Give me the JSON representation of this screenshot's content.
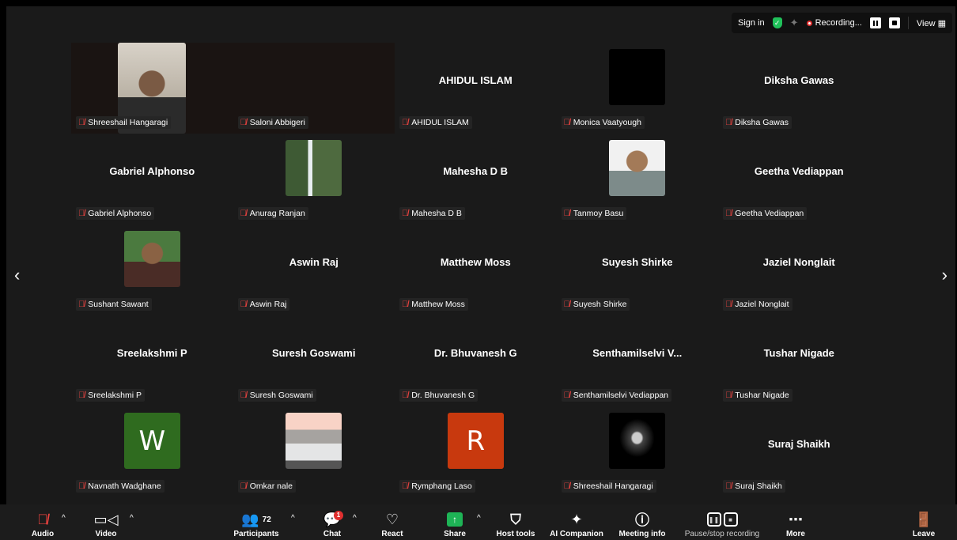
{
  "topbar": {
    "sign_in": "Sign in",
    "recording": "Recording...",
    "view": "View"
  },
  "tiles": [
    {
      "label": "Shreeshail Hangaragi",
      "name_center": ""
    },
    {
      "label": "Saloni Abbigeri",
      "name_center": ""
    },
    {
      "label": "AHIDUL ISLAM",
      "name_center": "AHIDUL ISLAM"
    },
    {
      "label": "Monica Vaatyough",
      "name_center": ""
    },
    {
      "label": "Diksha Gawas",
      "name_center": "Diksha Gawas"
    },
    {
      "label": "Gabriel Alphonso",
      "name_center": "Gabriel Alphonso"
    },
    {
      "label": "Anurag Ranjan",
      "name_center": ""
    },
    {
      "label": "Mahesha D B",
      "name_center": "Mahesha D B"
    },
    {
      "label": "Tanmoy Basu",
      "name_center": ""
    },
    {
      "label": "Geetha Vediappan",
      "name_center": "Geetha Vediappan"
    },
    {
      "label": "Sushant Sawant",
      "name_center": ""
    },
    {
      "label": "Aswin Raj",
      "name_center": "Aswin Raj"
    },
    {
      "label": "Matthew Moss",
      "name_center": "Matthew Moss"
    },
    {
      "label": "Suyesh Shirke",
      "name_center": "Suyesh Shirke"
    },
    {
      "label": "Jaziel Nonglait",
      "name_center": "Jaziel Nonglait"
    },
    {
      "label": "Sreelakshmi P",
      "name_center": "Sreelakshmi P"
    },
    {
      "label": "Suresh Goswami",
      "name_center": "Suresh Goswami"
    },
    {
      "label": "Dr. Bhuvanesh G",
      "name_center": "Dr. Bhuvanesh G"
    },
    {
      "label": "Senthamilselvi Vediappan",
      "name_center": "Senthamilselvi  V..."
    },
    {
      "label": "Tushar Nigade",
      "name_center": "Tushar Nigade"
    },
    {
      "label": "Navnath Wadghane",
      "name_center": "",
      "avatar_letter": "W"
    },
    {
      "label": "Omkar nale",
      "name_center": ""
    },
    {
      "label": "Rymphang Laso",
      "name_center": "",
      "avatar_letter": "R"
    },
    {
      "label": "Shreeshail Hangaragi",
      "name_center": ""
    },
    {
      "label": "Suraj Shaikh",
      "name_center": "Suraj Shaikh"
    }
  ],
  "toolbar": {
    "audio": "Audio",
    "video": "Video",
    "participants": "Participants",
    "participants_count": "72",
    "chat": "Chat",
    "chat_badge": "1",
    "react": "React",
    "share": "Share",
    "host_tools": "Host tools",
    "ai_companion": "AI Companion",
    "meeting_info": "Meeting info",
    "pause_recording": "Pause/stop recording",
    "more": "More",
    "leave": "Leave"
  },
  "colors": {
    "avatar_w": "#2f6b1f",
    "avatar_r": "#c8390e",
    "mute_red": "#e8423f",
    "share_green": "#1eb456"
  }
}
